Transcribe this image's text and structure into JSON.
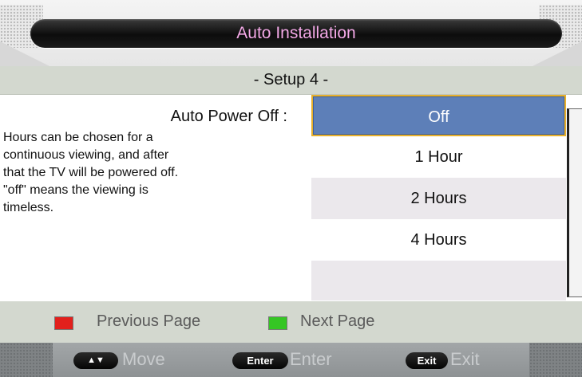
{
  "title": "Auto Installation",
  "setup_label": "- Setup 4 -",
  "option": {
    "title": "Auto Power Off :",
    "description_lines": [
      "Hours can be chosen for a",
      "continuous viewing, and after",
      "that the TV will be powered off.",
      "\"off\" means the viewing is",
      "timeless."
    ]
  },
  "choices": [
    {
      "label": "Off",
      "selected": true
    },
    {
      "label": "1 Hour",
      "selected": false
    },
    {
      "label": "2 Hours",
      "selected": false
    },
    {
      "label": "4 Hours",
      "selected": false
    }
  ],
  "color_keys": {
    "previous_label": "Previous Page",
    "next_label": "Next Page",
    "red_color": "#e2201c",
    "green_color": "#35c624"
  },
  "nav": {
    "move_key": "▲▼",
    "move_label": "Move",
    "enter_key": "Enter",
    "enter_label": "Enter",
    "exit_key": "Exit",
    "exit_label": "Exit"
  },
  "colors": {
    "title_text": "#f3a8e6",
    "selection_fill": "#5d7fb8",
    "selection_border": "#e8b02a",
    "panel_bar": "#d3d8cf"
  }
}
